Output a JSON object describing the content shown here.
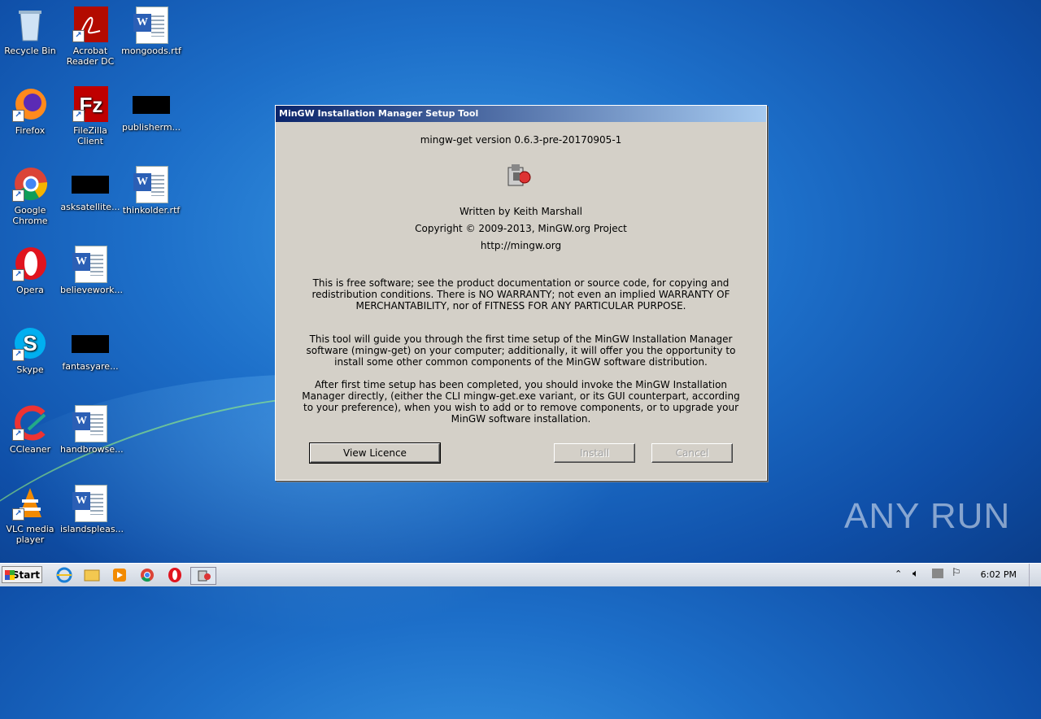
{
  "desktop": {
    "icons": [
      {
        "label": "Recycle Bin"
      },
      {
        "label": "Acrobat Reader DC"
      },
      {
        "label": "mongoods.rtf"
      },
      {
        "label": "Firefox"
      },
      {
        "label": "FileZilla Client"
      },
      {
        "label": "publisherm..."
      },
      {
        "label": "Google Chrome"
      },
      {
        "label": "asksatellite..."
      },
      {
        "label": "thinkolder.rtf"
      },
      {
        "label": "Opera"
      },
      {
        "label": "believework..."
      },
      {
        "label": "Skype"
      },
      {
        "label": "fantasyare..."
      },
      {
        "label": "CCleaner"
      },
      {
        "label": "handbrowse..."
      },
      {
        "label": "VLC media player"
      },
      {
        "label": "islandspleas..."
      }
    ]
  },
  "dialog": {
    "title": "MinGW Installation Manager Setup Tool",
    "version": "mingw-get version 0.6.3-pre-20170905-1",
    "author": "Written by Keith Marshall",
    "copyright": "Copyright © 2009-2013, MinGW.org Project",
    "url": "http://mingw.org",
    "license_text": "This is free software; see the product documentation or source code, for copying and redistribution conditions.  There is NO WARRANTY; not even an implied WARRANTY OF MERCHANTABILITY, nor of FITNESS FOR ANY PARTICULAR PURPOSE.",
    "guide_text": "This tool will guide you through the first time setup of the MinGW Installation Manager software (mingw-get) on your computer; additionally, it will offer you the opportunity to install some other common components of the MinGW software distribution.",
    "after_text": "After first time setup has been completed, you should invoke the MinGW Installation Manager directly, (either the CLI mingw-get.exe variant, or its GUI counterpart, according to your preference), when you wish to add or to remove components, or to upgrade your MinGW software installation.",
    "buttons": {
      "view_licence": "View Licence",
      "install": "Install",
      "cancel": "Cancel"
    }
  },
  "taskbar": {
    "start_label": "Start",
    "clock": "6:02 PM"
  },
  "watermark": "ANY RUN"
}
